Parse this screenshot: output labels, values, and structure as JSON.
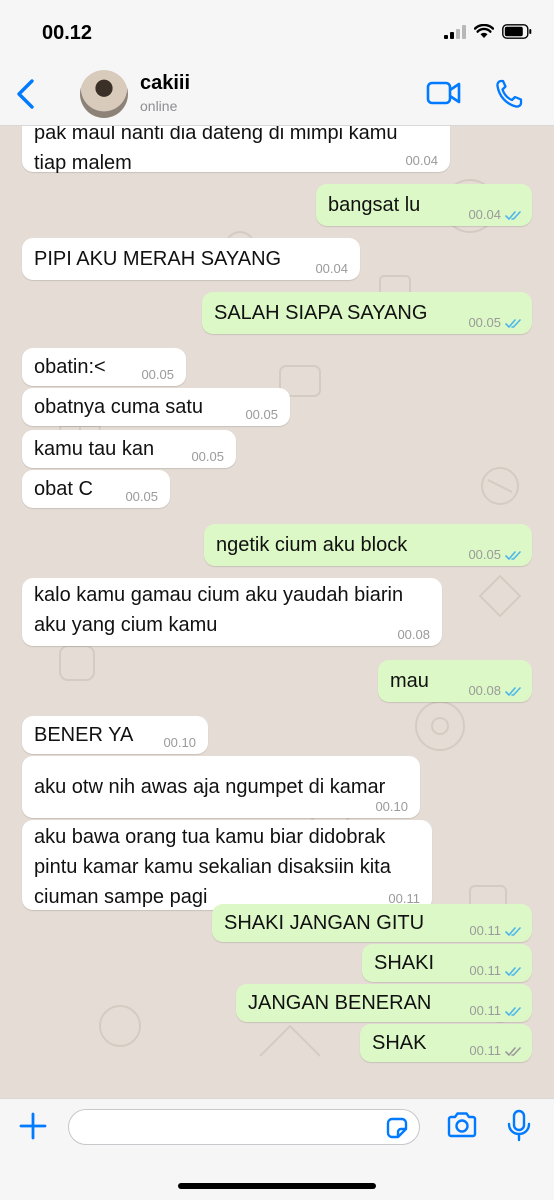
{
  "status_bar": {
    "time": "00.12"
  },
  "header": {
    "contact_name": "cakiii",
    "contact_status": "online"
  },
  "messages": [
    {
      "dir": "in",
      "text": "pak maul nanti dia dateng di mimpi kamu\ntiap malem",
      "time": "00.04"
    },
    {
      "dir": "out",
      "text": "bangsat lu",
      "time": "00.04",
      "read": true
    },
    {
      "dir": "in",
      "text": "PIPI AKU MERAH SAYANG",
      "time": "00.04"
    },
    {
      "dir": "out",
      "text": "SALAH SIAPA SAYANG",
      "time": "00.05",
      "read": true
    },
    {
      "dir": "in",
      "text": "obatin:<",
      "time": "00.05"
    },
    {
      "dir": "in",
      "text": "obatnya cuma satu",
      "time": "00.05"
    },
    {
      "dir": "in",
      "text": "kamu tau kan",
      "time": "00.05"
    },
    {
      "dir": "in",
      "text": "obat C",
      "time": "00.05"
    },
    {
      "dir": "out",
      "text": "ngetik cium aku block",
      "time": "00.05",
      "read": true
    },
    {
      "dir": "in",
      "text": "kalo kamu gamau cium aku yaudah biarin\naku yang cium kamu",
      "time": "00.08"
    },
    {
      "dir": "out",
      "text": "mau",
      "time": "00.08",
      "read": true
    },
    {
      "dir": "in",
      "text": "BENER YA",
      "time": "00.10"
    },
    {
      "dir": "in",
      "text": "aku otw nih awas aja ngumpet di kamar",
      "time": "00.10"
    },
    {
      "dir": "in",
      "text": "aku bawa orang tua kamu biar didobrak\npintu kamar kamu sekalian disaksiin kita\nciuman sampe pagi",
      "time": "00.11"
    },
    {
      "dir": "out",
      "text": "SHAKI JANGAN GITU",
      "time": "00.11",
      "read": true
    },
    {
      "dir": "out",
      "text": "SHAKI",
      "time": "00.11",
      "read": true
    },
    {
      "dir": "out",
      "text": "JANGAN BENERAN",
      "time": "00.11",
      "read": true
    },
    {
      "dir": "out",
      "text": "SHAK",
      "time": "00.11",
      "read": false
    }
  ],
  "composer": {
    "value": ""
  },
  "icons": {
    "back": "chevron-left-icon",
    "video": "video-camera-icon",
    "call": "phone-icon",
    "plus": "plus-icon",
    "sticker": "sticker-icon",
    "camera": "camera-icon",
    "mic": "microphone-icon",
    "signal": "signal-bars-icon",
    "wifi": "wifi-icon",
    "battery": "battery-icon"
  },
  "colors": {
    "accent": "#007aff",
    "read_tick": "#4fb6ec",
    "delivered_tick": "#9a9a9a",
    "incoming_bubble": "#ffffff",
    "outgoing_bubble": "#dcf8c6",
    "chat_bg": "#e5ddd5"
  }
}
